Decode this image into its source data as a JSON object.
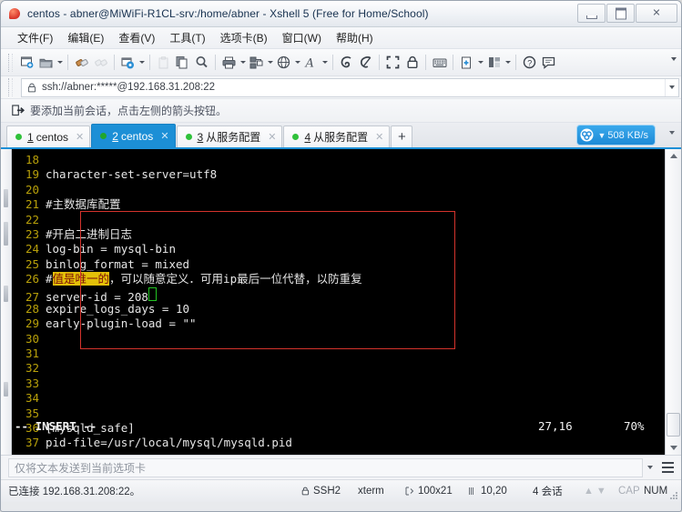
{
  "window": {
    "title": "centos - abner@MiWiFi-R1CL-srv:/home/abner - Xshell 5 (Free for Home/School)",
    "minimize_label": "",
    "maximize_label": "",
    "close_label": "✕"
  },
  "menubar": {
    "items": [
      {
        "label": "文件(F)",
        "name": "menu-file"
      },
      {
        "label": "编辑(E)",
        "name": "menu-edit"
      },
      {
        "label": "查看(V)",
        "name": "menu-view"
      },
      {
        "label": "工具(T)",
        "name": "menu-tools"
      },
      {
        "label": "选项卡(B)",
        "name": "menu-tabs"
      },
      {
        "label": "窗口(W)",
        "name": "menu-window"
      },
      {
        "label": "帮助(H)",
        "name": "menu-help"
      }
    ]
  },
  "toolbar": {
    "icons": [
      "new-session-icon",
      "open-folder-icon",
      "connect-icon",
      "disconnect-icon",
      "session-properties-icon",
      "paste-disabled-icon",
      "copy-icon",
      "find-icon",
      "print-icon",
      "transfer-icon",
      "globe-icon",
      "font-icon",
      "ssh-tunnel-icon",
      "secure-link-icon",
      "fullscreen-icon",
      "lock-icon",
      "keyboard-icon",
      "add-layout-icon",
      "arrange-icon",
      "help-icon",
      "feedback-icon"
    ]
  },
  "address": {
    "lock_icon": "lock-icon",
    "value": "ssh://abner:*****@192.168.31.208:22"
  },
  "hint": {
    "icon": "add-session-icon",
    "text": "要添加当前会话，点击左侧的箭头按钮。"
  },
  "tabs": {
    "items": [
      {
        "num": "1",
        "label": "centos",
        "active": false
      },
      {
        "num": "2",
        "label": "centos",
        "active": true
      },
      {
        "num": "3",
        "label": "从服务配置",
        "active": false
      },
      {
        "num": "4",
        "label": "从服务配置",
        "active": false
      }
    ],
    "add_label": "+",
    "close_glyph": "✕"
  },
  "netbadge": {
    "icon": "baidu-cloud-icon",
    "arrow": "▼",
    "speed": "508 KB/s"
  },
  "terminal": {
    "lines": [
      {
        "num": "18",
        "text": ""
      },
      {
        "num": "19",
        "text": "character-set-server=utf8"
      },
      {
        "num": "20",
        "text": ""
      },
      {
        "num": "21",
        "text": "#主数据库配置"
      },
      {
        "num": "22",
        "text": ""
      },
      {
        "num": "23",
        "text": "#开启二进制日志"
      },
      {
        "num": "24",
        "text": "log-bin = mysql-bin"
      },
      {
        "num": "25",
        "text": "binlog_format = mixed"
      },
      {
        "num": "26",
        "prefix": "#",
        "highlight": "值是唯一的",
        "suffix": "，可以随意定义．可用ip最后一位代替，以防重复"
      },
      {
        "num": "27",
        "text": "server-id = 208",
        "cursor": true
      },
      {
        "num": "28",
        "text": "expire_logs_days = 10"
      },
      {
        "num": "29",
        "text": "early-plugin-load = \"\""
      },
      {
        "num": "30",
        "text": ""
      },
      {
        "num": "31",
        "text": ""
      },
      {
        "num": "32",
        "text": ""
      },
      {
        "num": "33",
        "text": ""
      },
      {
        "num": "34",
        "text": ""
      },
      {
        "num": "35",
        "text": ""
      },
      {
        "num": "36",
        "text": "[mysqld_safe]"
      },
      {
        "num": "37",
        "text": "pid-file=/usr/local/mysql/mysqld.pid"
      }
    ],
    "status": {
      "mode": "-- INSERT --",
      "position": "27,16",
      "percent": "70%"
    },
    "annotation_color": "#d4332c",
    "highlight_bg": "#e3c009",
    "highlight_fg": "#7e1008",
    "cursor_color": "#22c422"
  },
  "sendbar": {
    "placeholder": "仅将文本发送到当前选项卡",
    "value": "",
    "menu_icon": "hamburger-menu-icon",
    "dropdown_icon": "chevron-down-icon"
  },
  "statusbar": {
    "connection": "已连接 192.168.31.208:22。",
    "protocol_icon": "lock-icon",
    "protocol": "SSH2",
    "terminal_type": "xterm",
    "size_icon": "size-icon",
    "size": "100x21",
    "cursor_icon": "cursor-icon",
    "cursor": "10,20",
    "sessions": "4 会话",
    "cap": "CAP",
    "num": "NUM"
  }
}
